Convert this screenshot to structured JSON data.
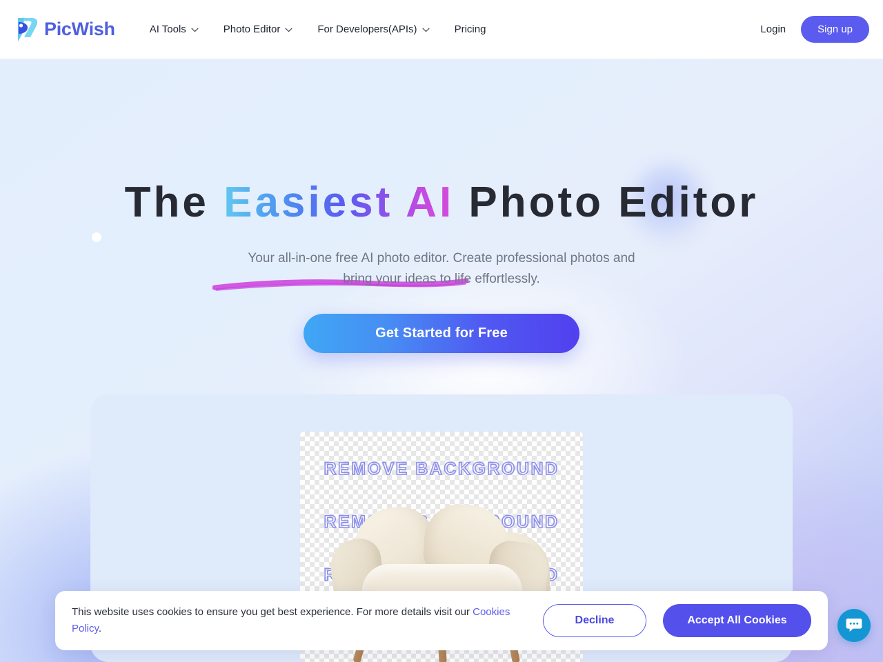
{
  "header": {
    "logo_text": "PicWish",
    "nav": [
      {
        "label": "AI Tools",
        "has_chevron": true
      },
      {
        "label": "Photo Editor",
        "has_chevron": true
      },
      {
        "label": "For Developers(APIs)",
        "has_chevron": true
      },
      {
        "label": "Pricing",
        "has_chevron": false
      }
    ],
    "login_label": "Login",
    "signup_label": "Sign up"
  },
  "hero": {
    "title_part1": "The ",
    "title_highlight": "Easiest AI",
    "title_part2": " Photo Editor",
    "subtitle_line1": "Your all-in-one free AI photo editor. Create professional photos and",
    "subtitle_line2": "bring your ideas to life effortlessly.",
    "cta_label": "Get Started for Free"
  },
  "showcase": {
    "watermark_row1": "REMOVE  BACKGROUND",
    "watermark_row2": "REMOVE  BACKGROUND",
    "watermark_row3": "REMOVE  BACKGROUND"
  },
  "cookie": {
    "text_before_link": "This website uses cookies to ensure you get best experience. For more details visit our ",
    "link_label": "Cookies Policy",
    "text_after_link": ".",
    "decline_label": "Decline",
    "accept_label": "Accept All Cookies"
  },
  "chat": {
    "icon": "chat-bubble-icon"
  },
  "colors": {
    "brand_indigo": "#5b5bf0",
    "logo_blue": "#4f5fe0",
    "logo_cyan": "#6fd0f5",
    "cta_gradient_start": "#3fa7f5",
    "cta_gradient_end": "#5140ef",
    "accept_button": "#5450ec",
    "chat_fab": "#1596d4",
    "underline_brush": "#d04be0",
    "card_bg": "#dfeafb",
    "watermark_stroke": "#8c8ef0"
  }
}
